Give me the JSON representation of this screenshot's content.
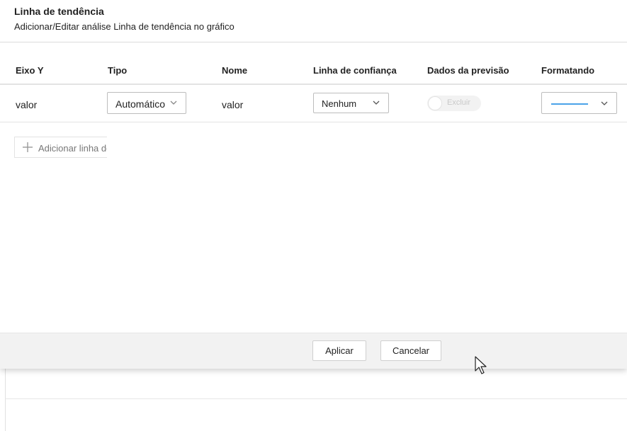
{
  "dialog": {
    "title": "Linha de tendência",
    "subtitle": "Adicionar/Editar análise Linha de tendência no gráfico"
  },
  "table": {
    "headers": {
      "y_axis": "Eixo Y",
      "type": "Tipo",
      "name": "Nome",
      "confidence_line": "Linha de confiança",
      "forecast_data": "Dados da previsão",
      "formatting": "Formatando"
    },
    "rows": [
      {
        "y_axis": "valor",
        "type": "Automático",
        "name": "valor",
        "confidence_line": "Nenhum",
        "forecast_toggle_label": "Excluir",
        "forecast_enabled": false,
        "line_color": "#4aa3e8"
      }
    ]
  },
  "add_trendline_label": "Adicionar linha de tendência",
  "footer": {
    "apply_label": "Aplicar",
    "cancel_label": "Cancelar"
  }
}
